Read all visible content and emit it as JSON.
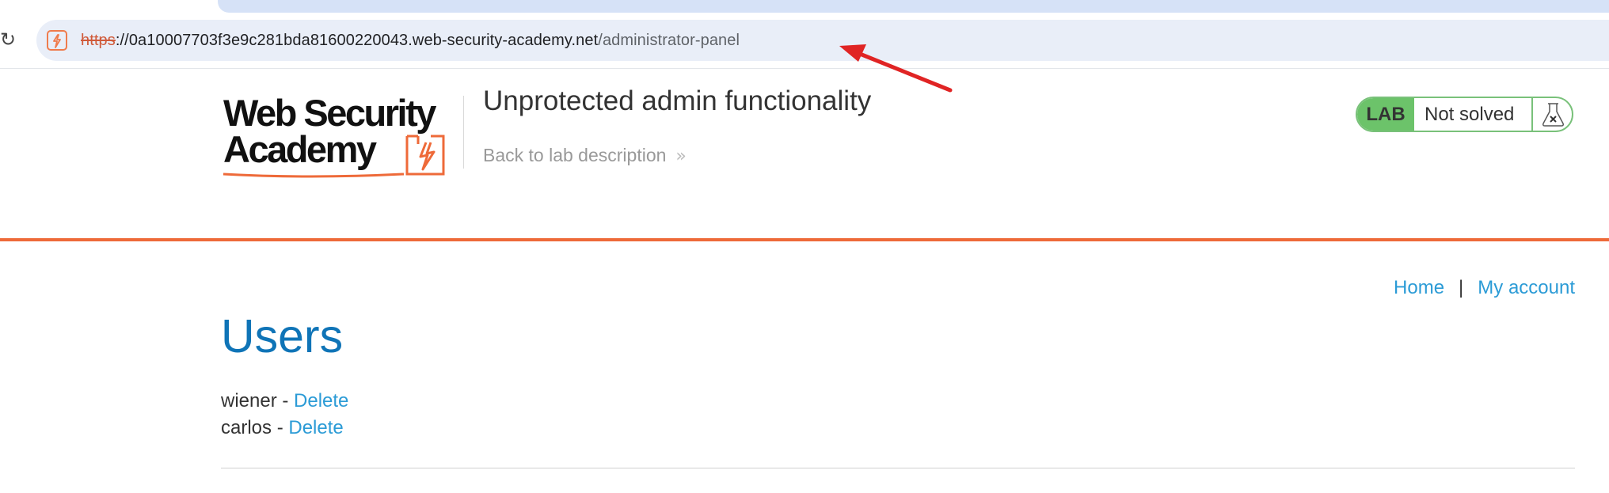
{
  "browser": {
    "url_scheme": "https",
    "url_host": "://0a10007703f3e9c281bda81600220043.web-security-academy.net",
    "url_path": "/administrator-panel"
  },
  "header": {
    "logo_line1": "Web Security",
    "logo_line2": "Academy",
    "lab_title": "Unprotected admin functionality",
    "back_link": "Back to lab description",
    "status_label": "LAB",
    "status_value": "Not solved"
  },
  "nav": {
    "home": "Home",
    "separator": "|",
    "my_account": "My account"
  },
  "main": {
    "title": "Users",
    "users": [
      {
        "name": "wiener",
        "dash": " - ",
        "action": "Delete"
      },
      {
        "name": "carlos",
        "dash": " - ",
        "action": "Delete"
      }
    ]
  },
  "colors": {
    "accent_orange": "#ee6a39",
    "link_blue": "#2b9bd6",
    "title_blue": "#0f74b7",
    "lab_green": "#6cc36a",
    "annotation_red": "#e02424"
  },
  "icons": [
    "reload-icon",
    "site-favicon-icon",
    "chevron-right-icon",
    "flask-icon",
    "annotation-arrow-icon"
  ]
}
